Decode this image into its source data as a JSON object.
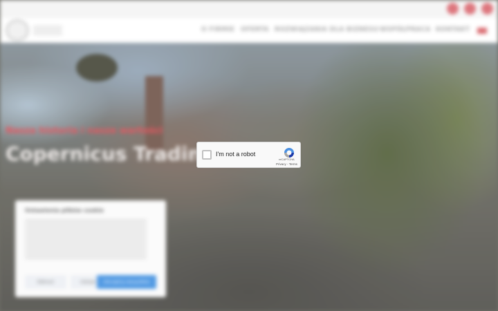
{
  "colors": {
    "brand_red": "#e3414c",
    "social_red": "#d9646c",
    "cookie_primary": "#3b8de0",
    "captcha_bg": "#f9f9f9"
  },
  "topbar": {
    "social_icons": [
      "facebook-icon",
      "instagram-icon",
      "linkedin-icon"
    ]
  },
  "nav": {
    "items": [
      {
        "label": "O FIRMIE"
      },
      {
        "label": "OFERTA"
      },
      {
        "label": "ROZWIĄZANIA DLA BIZNESU"
      },
      {
        "label": "WSPÓŁPRACA"
      },
      {
        "label": "KONTAKT"
      }
    ],
    "language_icon": "flag-icon"
  },
  "hero": {
    "subtitle": "Nasza historia i nasze wartości",
    "title": "Copernicus Trading"
  },
  "cookie": {
    "title": "Ustawienia plików cookie",
    "buttons": {
      "reject": "Odrzuć",
      "settings": "Ustaw",
      "accept": "Akceptuj wszystkie"
    }
  },
  "captcha": {
    "label": "I'm not a robot",
    "brand": "reCAPTCHA",
    "privacy": "Privacy",
    "separator": " - ",
    "terms": "Terms"
  }
}
